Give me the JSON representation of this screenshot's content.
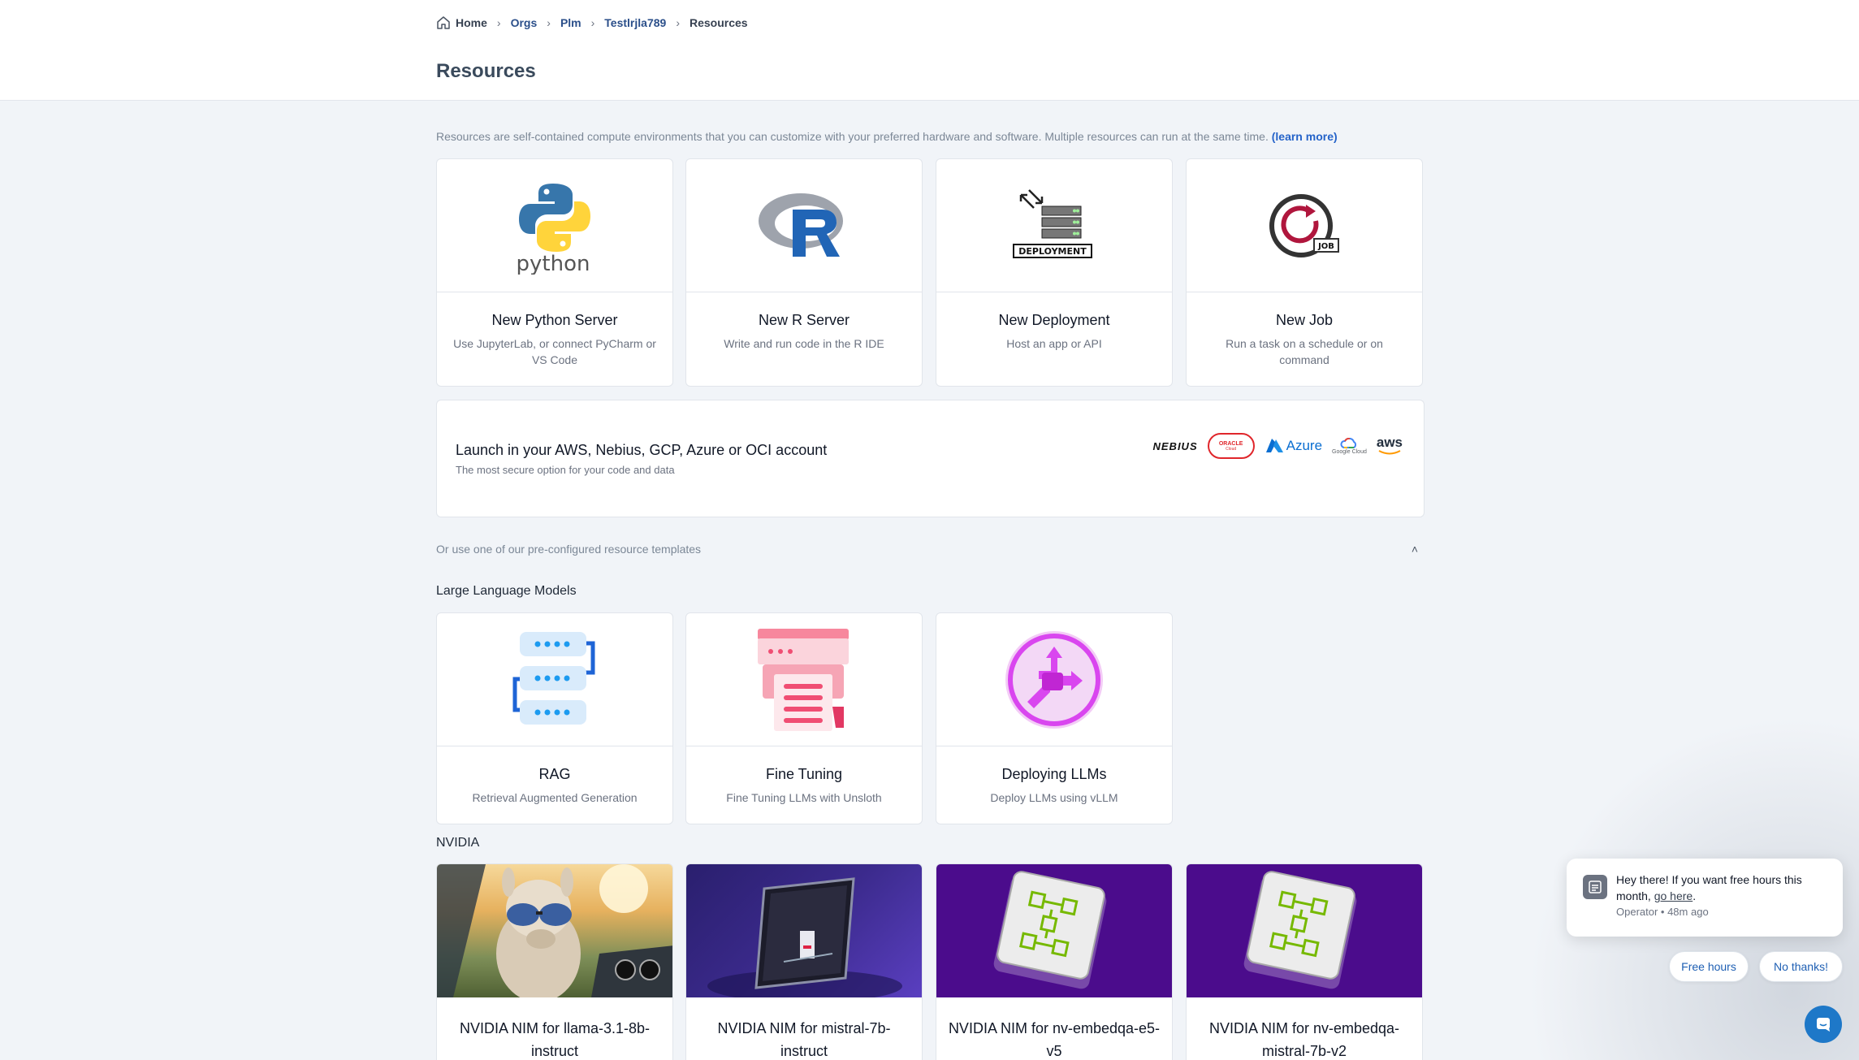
{
  "breadcrumb": {
    "home": "Home",
    "orgs": "Orgs",
    "org": "Plm",
    "project": "Testlrjla789",
    "current": "Resources"
  },
  "page": {
    "title": "Resources",
    "intro": "Resources are self-contained compute environments that you can customize with your preferred hardware and software. Multiple resources can run at the same time.",
    "learn_more": "(learn more)"
  },
  "resource_cards": [
    {
      "title": "New Python Server",
      "desc": "Use JupyterLab, or connect PyCharm or VS Code",
      "logo_text": "python"
    },
    {
      "title": "New R Server",
      "desc": "Write and run code in the R IDE",
      "logo_text": "R"
    },
    {
      "title": "New Deployment",
      "desc": "Host an app or API",
      "logo_text": "DEPLOYMENT"
    },
    {
      "title": "New Job",
      "desc": "Run a task on a schedule or on command",
      "logo_text": "JOB"
    }
  ],
  "launch": {
    "title": "Launch in your AWS, Nebius, GCP, Azure or OCI account",
    "subtitle": "The most secure option for your code and data",
    "logos": {
      "nebius": "NEBIUS",
      "oracle": "ORACLE",
      "oracle_sub": "Cloud",
      "azure": "Azure",
      "google": "Google Cloud",
      "aws": "aws"
    }
  },
  "templates": {
    "toggle_label": "Or use one of our pre-configured resource templates",
    "llm_section": "Large Language Models",
    "llm_cards": [
      {
        "title": "RAG",
        "desc": "Retrieval Augmented Generation"
      },
      {
        "title": "Fine Tuning",
        "desc": "Fine Tuning LLMs with Unsloth"
      },
      {
        "title": "Deploying LLMs",
        "desc": "Deploy LLMs using vLLM"
      }
    ],
    "nvidia_section": "NVIDIA",
    "nvidia_cards": [
      {
        "title": "NVIDIA NIM for llama-3.1-8b-instruct"
      },
      {
        "title": "NVIDIA NIM for mistral-7b-instruct"
      },
      {
        "title": "NVIDIA NIM for nv-embedqa-e5-v5"
      },
      {
        "title": "NVIDIA NIM for nv-embedqa-mistral-7b-v2"
      }
    ]
  },
  "chat": {
    "message_pre": "Hey there! If you want free hours this month,",
    "link": "go here",
    "message_post": ".",
    "meta": "Operator • 48m ago",
    "btn_free": "Free hours",
    "btn_no": "No thanks!"
  },
  "colors": {
    "accent": "#2563c9",
    "page_bg": "#f1f4f8",
    "nvidia_purple": "#4b0c8c",
    "launcher": "#1e78c8"
  }
}
